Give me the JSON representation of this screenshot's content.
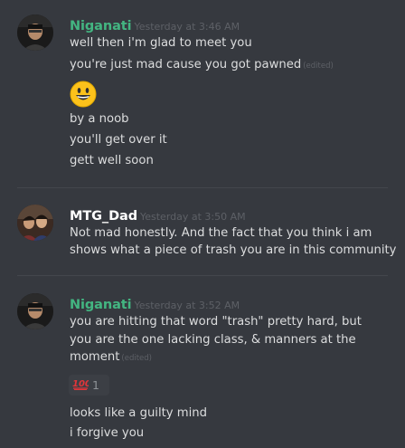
{
  "colors": {
    "background": "#36393f",
    "username_niganati": "#43b581",
    "username_mtg": "#ffffff",
    "text": "#dcddde",
    "muted": "#5d6066"
  },
  "messages": [
    {
      "author": "Niganati",
      "timestamp": "Yesterday at 3:46 AM",
      "lines": [
        "well then i'm glad to meet you",
        "you're just mad cause you got pawned",
        "by a noob",
        "you'll get over it",
        "gett well soon"
      ],
      "edited_label": "(edited)",
      "emoji": "grinning-face-icon"
    },
    {
      "author": "MTG_Dad",
      "timestamp": "Yesterday at 3:50 AM",
      "lines": [
        "Not mad honestly.  And the fact that you think i am",
        "shows what a piece of trash you are in this community"
      ]
    },
    {
      "author": "Niganati",
      "timestamp": "Yesterday at 3:52 AM",
      "lines": [
        "you are hitting that word \"trash\" pretty hard, but",
        "you are the one lacking class, & manners at the",
        "moment",
        "looks like a guilty mind",
        "i forgive you"
      ],
      "edited_label": "(edited)",
      "reaction": {
        "emoji": "hundred-points-icon",
        "count": "1"
      }
    }
  ]
}
